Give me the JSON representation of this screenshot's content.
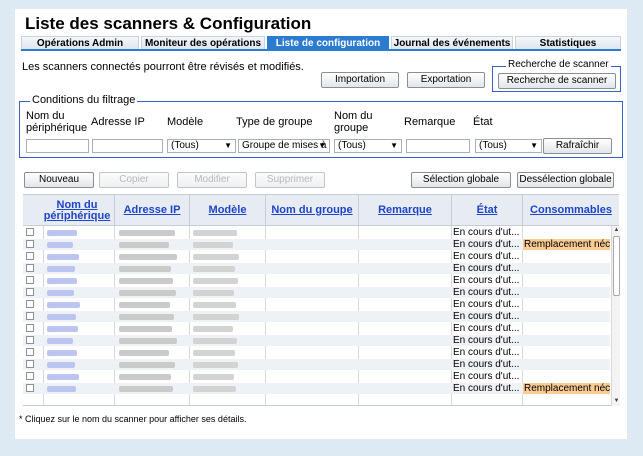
{
  "title": "Liste des scanners & Configuration",
  "tabs": [
    {
      "label": "Opérations Admin"
    },
    {
      "label": "Moniteur des opérations"
    },
    {
      "label": "Liste de configuration"
    },
    {
      "label": "Journal des événements"
    },
    {
      "label": "Statistiques"
    }
  ],
  "active_tab": "Liste de configuration",
  "description": "Les scanners connectés pourront être révisés et modifiés.",
  "buttons": {
    "import": "Importation",
    "export": "Exportation",
    "search": "Recherche de scanner",
    "refresh": "Rafraîchir",
    "new": "Nouveau",
    "copy": "Copier",
    "modify": "Modifier",
    "delete": "Supprimer",
    "select_all": "Sélection globale",
    "deselect_all": "Dessélection globale"
  },
  "scanner_search": {
    "legend": "Recherche de scanner"
  },
  "filter": {
    "legend": "Conditions du filtrage",
    "labels": {
      "device_name": "Nom du\npériphérique",
      "ip": "Adresse IP",
      "model": "Modèle",
      "group_type": "Type de groupe",
      "group_name": "Nom du\ngroupe",
      "remark": "Remarque",
      "state": "État"
    },
    "values": {
      "model": "(Tous)",
      "group_type": "Groupe de mises à",
      "group_name": "(Tous)",
      "state": "(Tous)"
    }
  },
  "table": {
    "columns": [
      "Nom du\npériphérique",
      "Adresse IP",
      "Modèle",
      "Nom du groupe",
      "Remarque",
      "État",
      "Consommables"
    ],
    "rows": [
      {
        "state": "En cours d'ut...",
        "consumables": ""
      },
      {
        "state": "En cours d'ut...",
        "consumables": "Remplacement néc..."
      },
      {
        "state": "En cours d'ut...",
        "consumables": ""
      },
      {
        "state": "En cours d'ut...",
        "consumables": ""
      },
      {
        "state": "En cours d'ut...",
        "consumables": ""
      },
      {
        "state": "En cours d'ut...",
        "consumables": ""
      },
      {
        "state": "En cours d'ut...",
        "consumables": ""
      },
      {
        "state": "En cours d'ut...",
        "consumables": ""
      },
      {
        "state": "En cours d'ut...",
        "consumables": ""
      },
      {
        "state": "En cours d'ut...",
        "consumables": ""
      },
      {
        "state": "En cours d'ut...",
        "consumables": ""
      },
      {
        "state": "En cours d'ut...",
        "consumables": ""
      },
      {
        "state": "En cours d'ut...",
        "consumables": ""
      },
      {
        "state": "En cours d'ut...",
        "consumables": "Remplacement néc..."
      }
    ]
  },
  "footnote": "* Cliquez sur le nom du scanner pour afficher ses détails.",
  "colors": {
    "accent": "#2b7bd1",
    "link": "#1d44c9",
    "warning": "#f9cc94",
    "frame": "#3a5fc4"
  },
  "icons": {
    "dropdown": "chevron-down-icon",
    "checkbox": "checkbox-icon"
  }
}
